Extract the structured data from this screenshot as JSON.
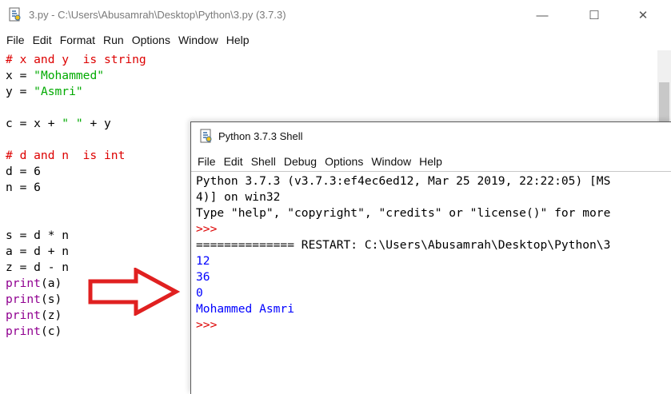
{
  "editor": {
    "title": "3.py - C:\\Users\\Abusamrah\\Desktop\\Python\\3.py (3.7.3)",
    "menu": [
      "File",
      "Edit",
      "Format",
      "Run",
      "Options",
      "Window",
      "Help"
    ],
    "controls": {
      "minimize": "—",
      "maximize": "☐",
      "close": "✕"
    },
    "code": [
      {
        "comment": "# x and y  is string"
      },
      {
        "pre": "x = ",
        "str": "\"Mohammed\""
      },
      {
        "pre": "y = ",
        "str": "\"Asmri\""
      },
      {
        "blank": ""
      },
      {
        "pre": "c = x + ",
        "str": "\" \"",
        "post": " + y"
      },
      {
        "blank": ""
      },
      {
        "comment": "# d and n  is int"
      },
      {
        "pre": "d = 6"
      },
      {
        "pre": "n = 6"
      },
      {
        "blank": ""
      },
      {
        "blank": ""
      },
      {
        "pre": "s = d * n"
      },
      {
        "pre": "a = d + n"
      },
      {
        "pre": "z = d - n"
      },
      {
        "fn": "print",
        "args": "(a)"
      },
      {
        "fn": "print",
        "args": "(s)"
      },
      {
        "fn": "print",
        "args": "(z)"
      },
      {
        "fn": "print",
        "args": "(c)"
      }
    ]
  },
  "shell": {
    "title": "Python 3.7.3 Shell",
    "menu": [
      "File",
      "Edit",
      "Shell",
      "Debug",
      "Options",
      "Window",
      "Help"
    ],
    "lines": [
      {
        "cls": "blk",
        "text": "Python 3.7.3 (v3.7.3:ef4ec6ed12, Mar 25 2019, 22:22:05) [MS"
      },
      {
        "cls": "blk",
        "text": "4)] on win32"
      },
      {
        "cls": "blk",
        "text": "Type \"help\", \"copyright\", \"credits\" or \"license()\" for more"
      },
      {
        "cls": "err",
        "text": ">>> "
      },
      {
        "cls": "blk",
        "text": "============== RESTART: C:\\Users\\Abusamrah\\Desktop\\Python\\3"
      },
      {
        "cls": "out",
        "text": "12"
      },
      {
        "cls": "out",
        "text": "36"
      },
      {
        "cls": "out",
        "text": "0"
      },
      {
        "cls": "out",
        "text": "Mohammed Asmri"
      },
      {
        "cls": "err",
        "text": ">>> "
      }
    ]
  },
  "colors": {
    "comment": "#dd0000",
    "string": "#00aa00",
    "builtin": "#900090",
    "output": "#0000ff",
    "prompt": "#dd0000",
    "arrow": "#e02020"
  }
}
